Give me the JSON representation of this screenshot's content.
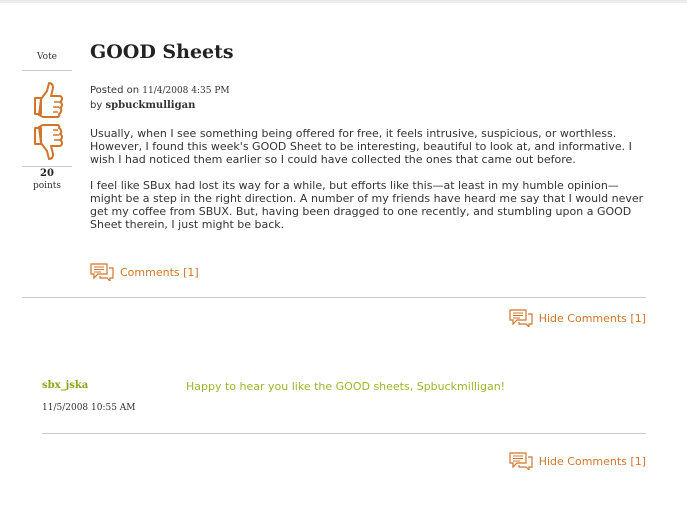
{
  "vote": {
    "label": "Vote",
    "count": "20",
    "unit": "points"
  },
  "post": {
    "title": "GOOD Sheets",
    "posted_prefix": "Posted on ",
    "date": "11/4/2008 4:35 PM",
    "by_prefix": "by ",
    "author": "spbuckmulligan",
    "paragraphs": [
      "Usually, when I see something being offered for free, it feels intrusive, suspicious, or worthless. However, I found this week's GOOD Sheet to be interesting, beautiful to look at, and informative. I wish I had noticed them earlier so I could have collected the ones that came out before.",
      "I feel like SBux had lost its way for a while, but efforts like this—at least in my humble opinion—might be a step in the right direction. A number of my friends have heard me say that I would never get my coffee from SBUX. But, having been dragged to one recently, and stumbling upon a GOOD Sheet therein, I just might be back."
    ],
    "comments_link": "Comments [1]"
  },
  "hide_comments_label": "Hide Comments [1]",
  "comments": [
    {
      "author": "sbx_jska",
      "text": "Happy to hear you like the GOOD sheets, Spbuckmilligan!",
      "date": "11/5/2008 10:55 AM"
    }
  ],
  "colors": {
    "accent_orange": "#d2752b",
    "comment_green": "#9db52c"
  },
  "icons": [
    "thumbs-up-icon",
    "thumbs-down-icon",
    "speech-bubble-icon"
  ]
}
